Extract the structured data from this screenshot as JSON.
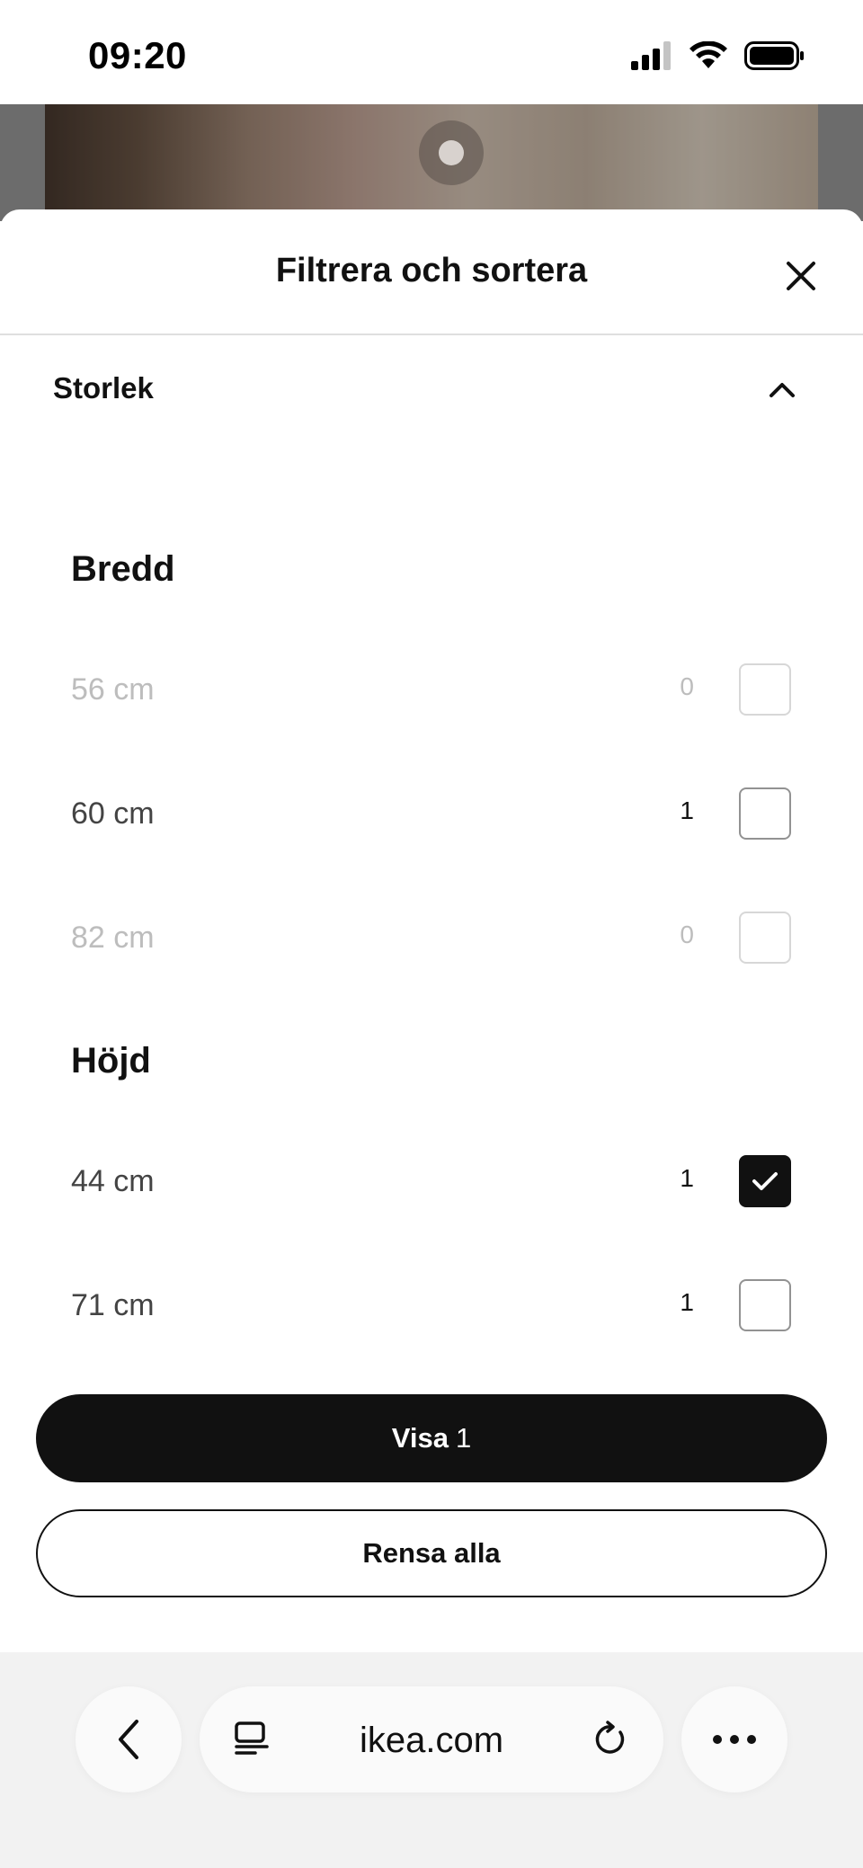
{
  "status_bar": {
    "time": "09:20"
  },
  "sheet": {
    "title": "Filtrera och sortera",
    "section": {
      "title": "Storlek",
      "expanded": true
    },
    "groups": [
      {
        "heading": "Bredd",
        "options": [
          {
            "label": "56 cm",
            "count": "0",
            "checked": false,
            "disabled": true
          },
          {
            "label": "60 cm",
            "count": "1",
            "checked": false,
            "disabled": false
          },
          {
            "label": "82 cm",
            "count": "0",
            "checked": false,
            "disabled": true
          }
        ]
      },
      {
        "heading": "Höjd",
        "options": [
          {
            "label": "44 cm",
            "count": "1",
            "checked": true,
            "disabled": false
          },
          {
            "label": "71 cm",
            "count": "1",
            "checked": false,
            "disabled": false
          }
        ]
      }
    ],
    "actions": {
      "show_label": "Visa",
      "show_count": "1",
      "clear_label": "Rensa alla"
    }
  },
  "browser": {
    "url": "ikea.com",
    "icons": [
      "back-chevron-icon",
      "reader-icon",
      "reload-icon",
      "more-icon"
    ]
  },
  "colors": {
    "primary": "#111111",
    "disabled_text": "#bdbdbd",
    "divider": "#dfdfdf",
    "browser_bg": "#f2f2f2"
  }
}
